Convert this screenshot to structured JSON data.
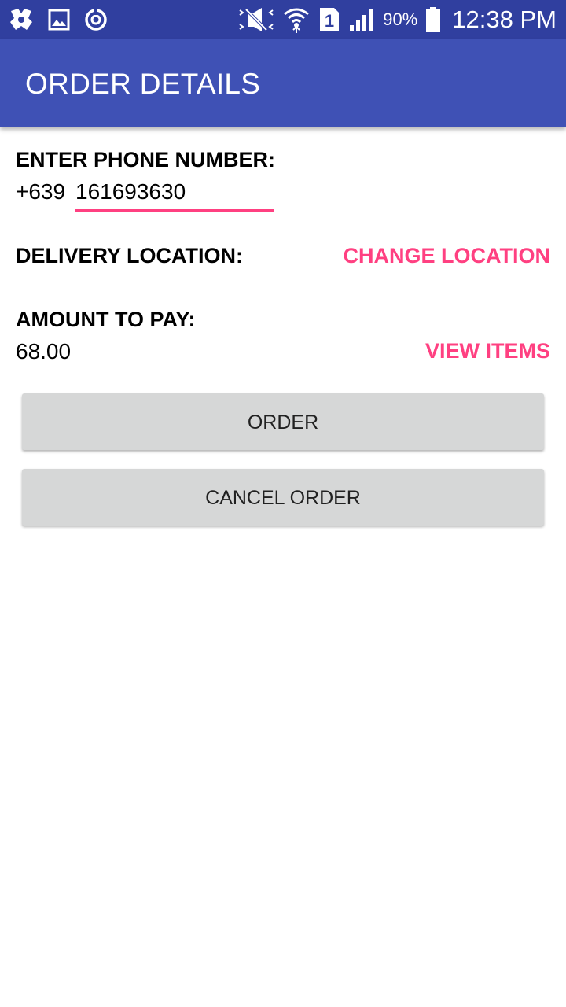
{
  "status_bar": {
    "background": "#303f9f",
    "left_icons": [
      "app-icon",
      "gallery-icon",
      "sync-icon"
    ],
    "right_icons": [
      "vibrate-icon",
      "wifi-icon",
      "sim-1-icon",
      "signal-icon",
      "battery-icon"
    ],
    "sim_label": "1",
    "battery_percent": "90%",
    "time": "12:38 PM"
  },
  "app_bar": {
    "background": "#3f51b5",
    "title": "ORDER DETAILS"
  },
  "phone": {
    "label": "ENTER PHONE NUMBER:",
    "prefix": "+639",
    "value": "161693630",
    "underline_color": "#ff4081"
  },
  "delivery": {
    "label": "DELIVERY LOCATION:",
    "change_link": "CHANGE LOCATION"
  },
  "amount": {
    "label": "AMOUNT TO PAY:",
    "value": "68.00",
    "view_link": "VIEW ITEMS"
  },
  "buttons": {
    "order": "ORDER",
    "cancel": "CANCEL ORDER"
  },
  "colors": {
    "accent": "#ff4081",
    "button_bg": "#d6d7d7"
  }
}
